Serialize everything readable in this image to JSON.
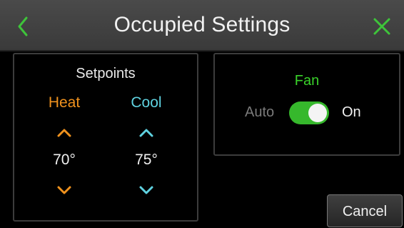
{
  "header": {
    "title": "Occupied Settings",
    "back_icon": "chevron-left-icon",
    "close_icon": "close-icon",
    "accent_color": "#3ec43a"
  },
  "setpoints": {
    "title": "Setpoints",
    "heat": {
      "label": "Heat",
      "value": "70°",
      "color": "#f0921e"
    },
    "cool": {
      "label": "Cool",
      "value": "75°",
      "color": "#5fd2e0"
    }
  },
  "fan": {
    "title": "Fan",
    "off_label": "Auto",
    "on_label": "On",
    "state": "On",
    "color": "#39d12a"
  },
  "footer": {
    "cancel_label": "Cancel"
  }
}
